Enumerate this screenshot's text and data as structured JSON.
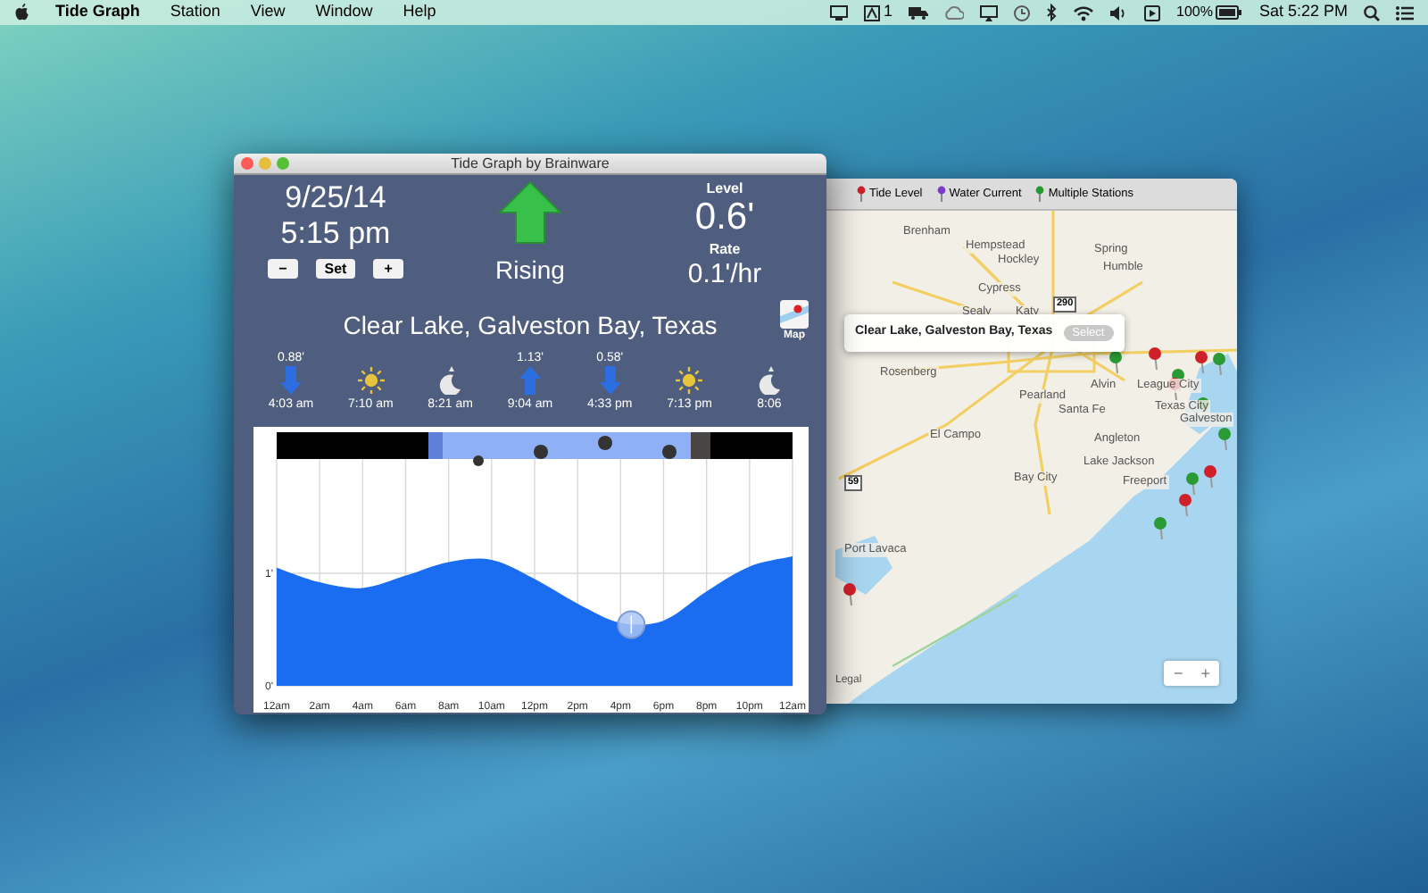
{
  "menu_bar": {
    "app": "Tide Graph",
    "items": [
      "Station",
      "View",
      "Window",
      "Help"
    ],
    "status": {
      "display_number": "1",
      "battery": "100%",
      "clock": "Sat 5:22 PM"
    }
  },
  "tide_window": {
    "title": "Tide Graph by Brainware",
    "date": "9/25/14",
    "time": "5:15 pm",
    "buttons": [
      "−",
      "Set",
      "+"
    ],
    "trend": "Rising",
    "level_label": "Level",
    "level": "0.6'",
    "rate_label": "Rate",
    "rate": "0.1'/hr",
    "location": "Clear Lake, Galveston Bay, Texas",
    "map_button": "Map",
    "events": [
      {
        "kind": "tide-low",
        "height": "0.88'",
        "time": "4:03 am"
      },
      {
        "kind": "sunrise",
        "time": "7:10 am"
      },
      {
        "kind": "moonset",
        "time": "8:21 am"
      },
      {
        "kind": "tide-high",
        "height": "1.13'",
        "time": "9:04 am"
      },
      {
        "kind": "tide-low",
        "height": "0.58'",
        "time": "4:33 pm"
      },
      {
        "kind": "sunset",
        "time": "7:13 pm"
      },
      {
        "kind": "moonrise",
        "time": "8:06"
      }
    ],
    "chart_data": {
      "type": "area",
      "grid": true,
      "categories": [
        "12am",
        "2am",
        "4am",
        "6am",
        "8am",
        "10am",
        "12pm",
        "2pm",
        "4pm",
        "6pm",
        "8pm",
        "10pm",
        "12am"
      ],
      "ylim": [
        0,
        2
      ],
      "yticks": [
        {
          "value": 0,
          "label": "0'"
        },
        {
          "value": 1,
          "label": "1'"
        }
      ],
      "series": [
        {
          "color": "#1a6cf0",
          "values": [
            1.05,
            0.92,
            0.87,
            0.98,
            1.1,
            1.12,
            0.95,
            0.73,
            0.56,
            0.58,
            0.84,
            1.06,
            1.15
          ]
        }
      ]
    }
  },
  "map_window": {
    "legend": [
      {
        "label": "Tide Level",
        "color": "#d0202a"
      },
      {
        "label": "Water Current",
        "color": "#7a3cc8"
      },
      {
        "label": "Multiple Stations",
        "color": "#1f9a2c"
      }
    ],
    "places": [
      "Brenham",
      "Hempstead",
      "Hockley",
      "Spring",
      "Humble",
      "Cypress",
      "Sealy",
      "Katy",
      "Rosenberg",
      "Pearland",
      "Alvin",
      "Santa Fe",
      "League City",
      "Texas City",
      "Galveston",
      "El Campo",
      "Bay City",
      "Angleton",
      "Lake Jackson",
      "Freeport",
      "Port Lavaca"
    ],
    "road_shields": [
      "290",
      "59"
    ],
    "callout": {
      "title": "Clear Lake, Galveston Bay, Texas",
      "button": "Select",
      "button_disabled": true
    },
    "zoom_buttons": [
      "−",
      "+"
    ],
    "legal": "Legal"
  }
}
